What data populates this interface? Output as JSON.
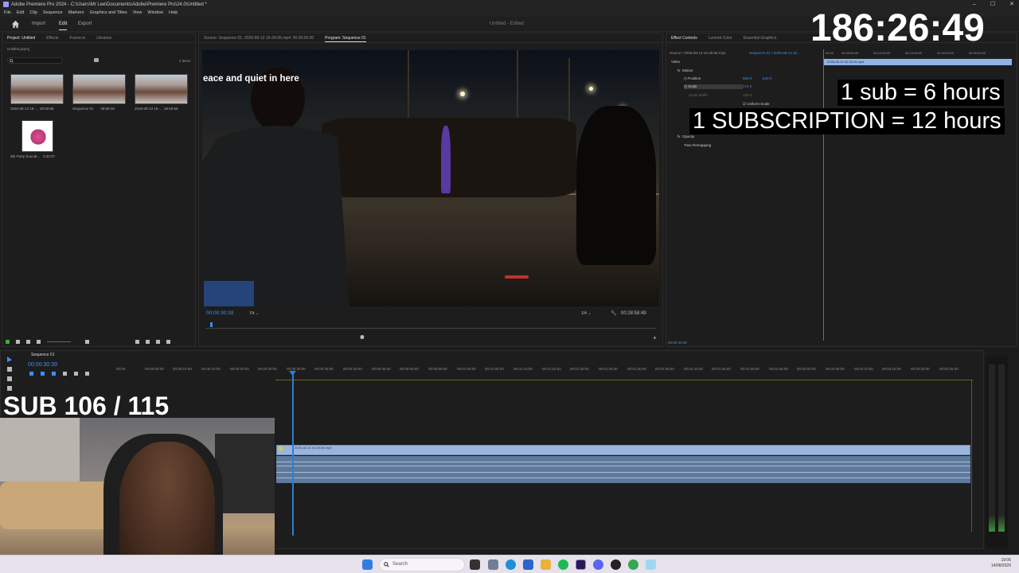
{
  "window": {
    "title": "Adobe Premiere Pro 2024 - C:\\Users\\Mr Lee\\Documents\\Adobe\\Premiere Pro\\24.0\\Untitled *",
    "controls": [
      "–",
      "☐",
      "✕"
    ]
  },
  "menu": [
    "File",
    "Edit",
    "Clip",
    "Sequence",
    "Markers",
    "Graphics and Titles",
    "View",
    "Window",
    "Help"
  ],
  "header": {
    "tabs": [
      "Import",
      "Edit",
      "Export"
    ],
    "active": "Edit",
    "doc_title": "Untitled - Edited"
  },
  "project": {
    "tabs": [
      "Project: Untitled",
      "Effects",
      "Frame.io",
      "Libraries"
    ],
    "file": "Untitled.prproj",
    "item_count": "4 items",
    "items": [
      {
        "name": "2026-08-13 16-...",
        "dur": "28:59:58"
      },
      {
        "name": "Sequence 01",
        "dur": "28:58:49"
      },
      {
        "name": "2026-08-13 16-...",
        "dur": "28:59:58"
      },
      {
        "name": "Wii Party Soundt...",
        "dur": "2:32:07"
      }
    ]
  },
  "source_tab": "Source: Sequence 01: 2026-08-13 16-39-06.mp4: 00:00:00:00",
  "program_tab": "Program: Sequence 01",
  "program": {
    "caption": "eace and quiet in here",
    "timecode": "00:00:30:39",
    "fit": "Fit",
    "res": "1/4",
    "duration": "00:28:58:49"
  },
  "effect_controls": {
    "tabs": [
      "Effect Controls",
      "Lumetri Color",
      "Essential Graphics"
    ],
    "source": "Source • 2026-08-13 16-39-06.mp4",
    "seq": "Sequence 01 • 2026-08-13 16...",
    "section": "Video",
    "rows": [
      {
        "label": "Motion"
      },
      {
        "label": "Position",
        "v1": "960.0",
        "v2": "540.0"
      },
      {
        "label": "Scale",
        "v1": "172.0"
      },
      {
        "label": "Scale Width",
        "v1": "100.0"
      },
      {
        "label": "Uniform Scale"
      },
      {
        "label": "Opacity"
      },
      {
        "label": "Time Remapping"
      }
    ],
    "ruler": [
      "00:00",
      "00:05:00:00",
      "00:10:00:00",
      "00:15:00:00",
      "00:20:00:00",
      "00:25:00:00"
    ],
    "clip": "2026-08-13 16-39-06.mp4",
    "timecode": "00:00:30:39"
  },
  "timeline": {
    "tab": "Sequence 01",
    "timecode": "00:00:30:39",
    "ruler": [
      "00:00",
      "00:00:05:00",
      "00:00:10:00",
      "00:00:15:00",
      "00:00:20:00",
      "00:00:25:00",
      "00:00:30:00",
      "00:00:35:00",
      "00:00:40:00",
      "00:00:45:00",
      "00:00:50:00",
      "00:00:55:00",
      "00:01:00:00",
      "00:01:05:00",
      "00:01:10:00",
      "00:01:15:00",
      "00:01:20:00",
      "00:01:25:00",
      "00:01:30:00",
      "00:01:35:00",
      "00:01:40:00",
      "00:01:45:00",
      "00:01:50:00",
      "00:01:55:00",
      "00:02:00:00",
      "00:02:05:00",
      "00:02:10:00",
      "00:02:15:00",
      "00:02:20:00",
      "00:02:25:00"
    ],
    "clip": "2026-08-13 16-39-06.mp4"
  },
  "overlays": {
    "timer": "186:26:49",
    "sub_rate": "1 sub = 6 hours",
    "subscription_rate": "1 SUBSCRIPTION = 12 hours",
    "sub_count": "SUB 106 / 115"
  },
  "taskbar": {
    "search": "Search",
    "time": "19:06",
    "date": "14/08/2026"
  },
  "colors": {
    "accent": "#2b7fd6",
    "clip_video": "#9ab5db",
    "clip_audio": "#5f7a9c",
    "overlay_bg": "#000000"
  }
}
